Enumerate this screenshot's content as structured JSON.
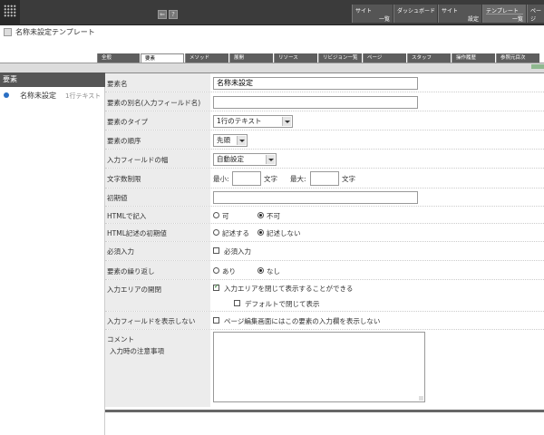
{
  "topbar": {
    "icons": [
      "back-icon",
      "help-icon"
    ],
    "back_glyph": "⇐",
    "help_glyph": "?",
    "links": [
      {
        "line1": "サイト",
        "line2": "一覧"
      },
      {
        "line1": "ダッシュボード",
        "line2": ""
      },
      {
        "line1": "サイト",
        "line2": "設定"
      },
      {
        "line1": "テンプレート",
        "line2": "一覧"
      },
      {
        "line1": "ページ",
        "line2": ""
      }
    ]
  },
  "page_title": "名称未設定テンプレート",
  "tabs": [
    "全般",
    "要素",
    "メソッド",
    "展開",
    "リソース",
    "リビジョン一覧",
    "ページ",
    "スタッフ",
    "操作履歴",
    "参照元目次"
  ],
  "active_tab": "要素",
  "sidebar": {
    "header": "要素",
    "items": [
      {
        "label": "名称未設定",
        "type": "1行テキスト"
      }
    ]
  },
  "form": {
    "element_name": {
      "label": "要素名",
      "value": "名称未設定"
    },
    "alias": {
      "label": "要素の別名(入力フィールド名)",
      "value": ""
    },
    "type": {
      "label": "要素のタイプ",
      "value": "1行のテキスト"
    },
    "order": {
      "label": "要素の順序",
      "value": "先頭"
    },
    "field_width": {
      "label": "入力フィールドの幅",
      "value": "自動設定"
    },
    "char_limit": {
      "label": "文字数制限",
      "min_label": "最小:",
      "max_label": "最大:",
      "unit": "文字",
      "min": "",
      "max": ""
    },
    "initial": {
      "label": "初期値",
      "value": ""
    },
    "html_input": {
      "label": "HTMLで記入",
      "options": [
        "可",
        "不可"
      ],
      "selected": "不可"
    },
    "html_initial": {
      "label": "HTML記述の初期値",
      "options": [
        "記述する",
        "記述しない"
      ],
      "selected": "記述しない"
    },
    "required": {
      "label": "必須入力",
      "checkbox": "必須入力",
      "checked": false
    },
    "repeat": {
      "label": "要素の繰り返し",
      "options": [
        "あり",
        "なし"
      ],
      "selected": "なし"
    },
    "collapse": {
      "label": "入力エリアの開閉",
      "checkbox1": "入力エリアを閉じて表示することができる",
      "checked1": true,
      "checkbox2": "デフォルトで閉じて表示",
      "checked2": false
    },
    "hide_field": {
      "label": "入力フィールドを表示しない",
      "checkbox": "ページ編集画面にはこの要素の入力欄を表示しない",
      "checked": false
    },
    "comment": {
      "label": "コメント",
      "sublabel": "入力時の注意事項",
      "value": ""
    }
  }
}
